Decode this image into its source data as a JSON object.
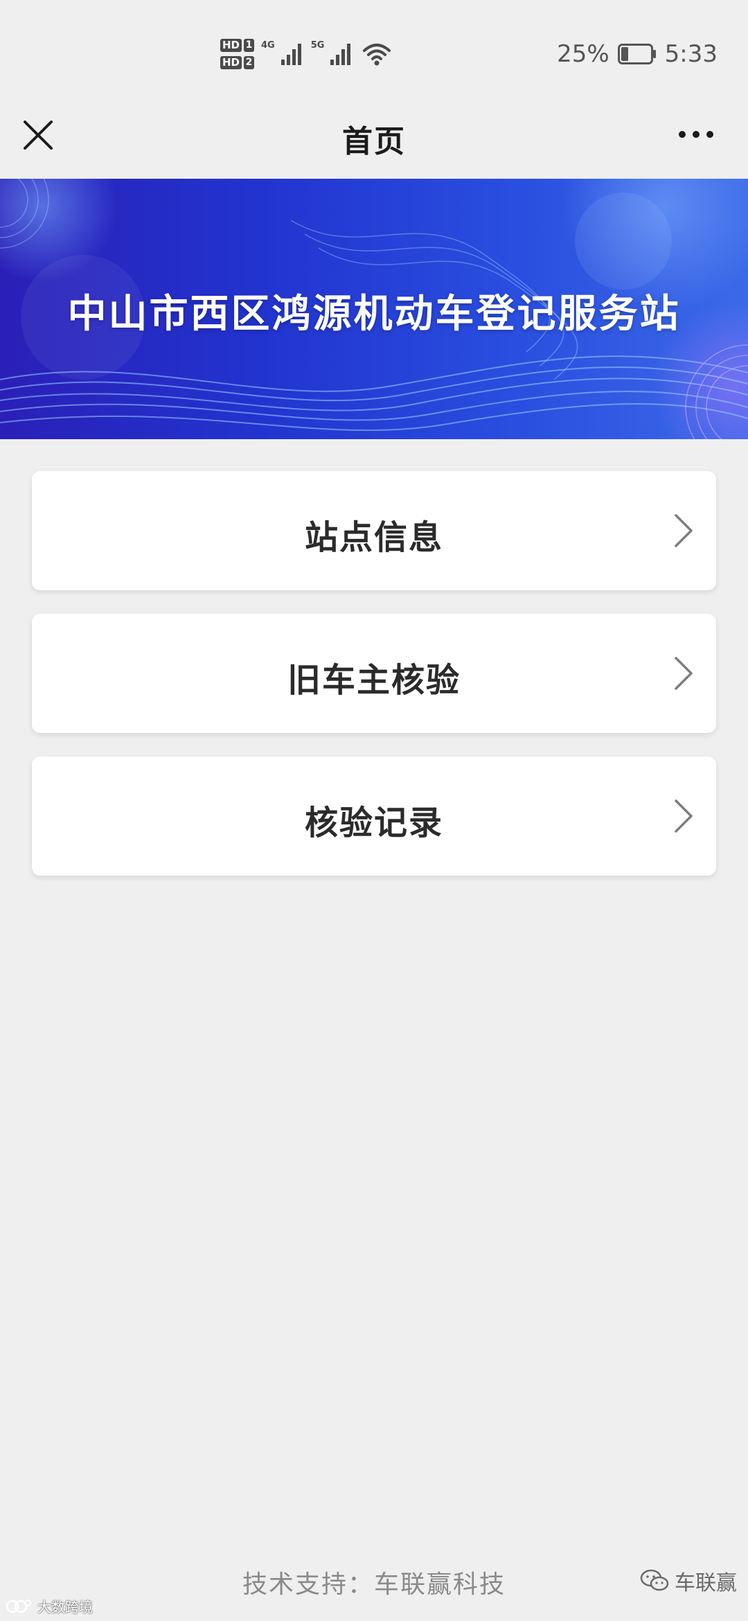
{
  "status_bar": {
    "hd1": "HD",
    "hd1_num": "1",
    "hd2": "HD",
    "hd2_num": "2",
    "net1": "4G",
    "net2": "5G",
    "battery": "25%",
    "battery_level": 0.25,
    "time": "5:33"
  },
  "nav": {
    "title": "首页",
    "close_icon": "close-icon",
    "more_icon": "more-icon"
  },
  "banner": {
    "title": "中山市西区鸿源机动车登记服务站"
  },
  "menu": {
    "items": [
      {
        "label": "站点信息",
        "icon": "chevron-right-icon"
      },
      {
        "label": "旧车主核验",
        "icon": "chevron-right-icon"
      },
      {
        "label": "核验记录",
        "icon": "chevron-right-icon"
      }
    ]
  },
  "footer": {
    "text": "技术支持：车联赢科技",
    "watermark_right": "车联赢",
    "watermark_left": "大数跨境"
  },
  "colors": {
    "banner_start": "#2a1fb8",
    "banner_end": "#3b6ae8",
    "background": "#efefef",
    "card": "#ffffff"
  }
}
